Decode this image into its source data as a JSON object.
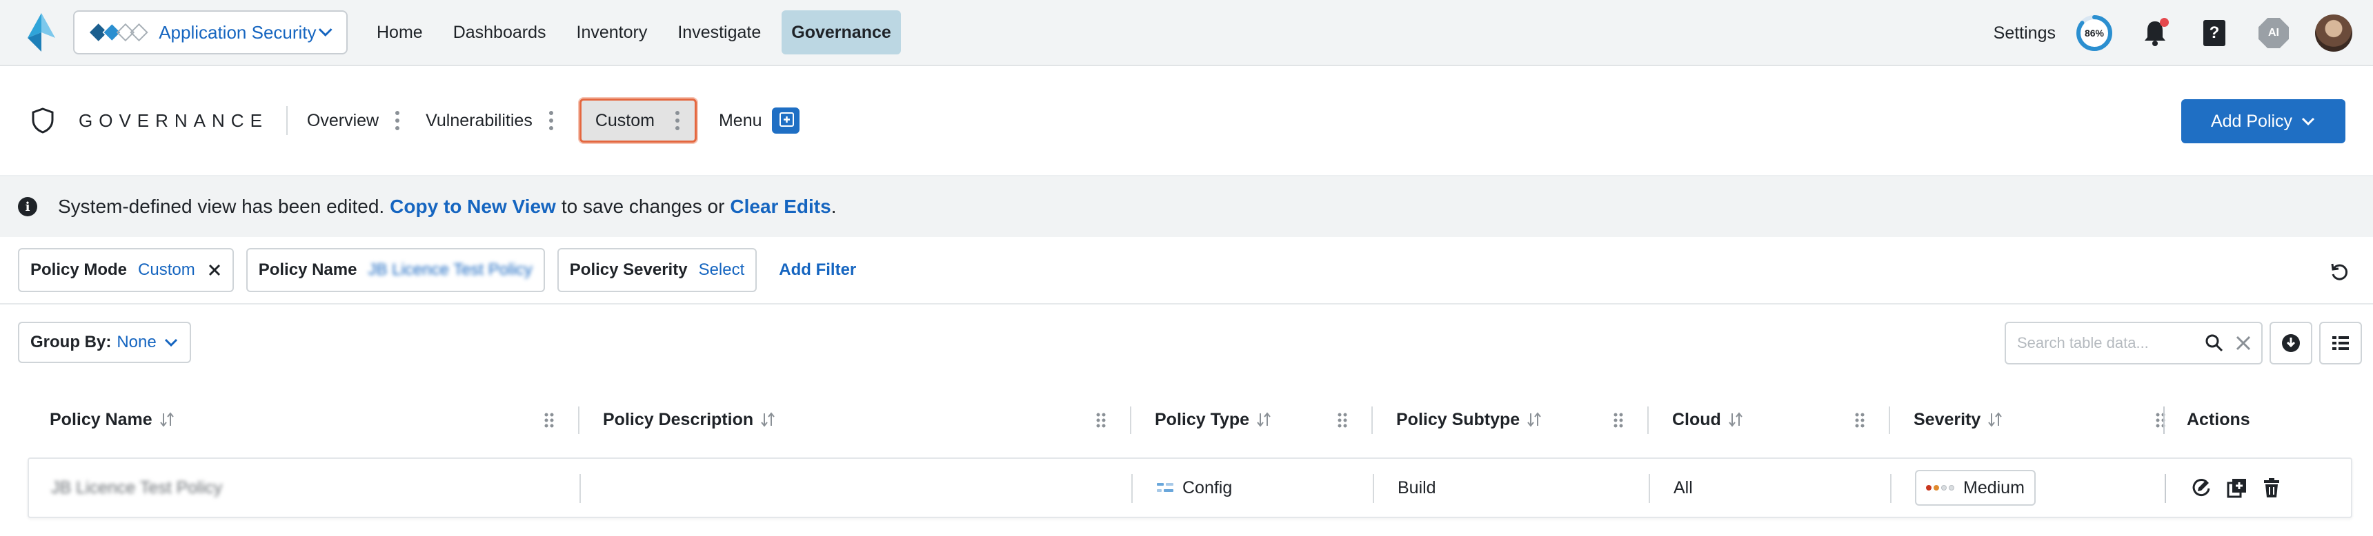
{
  "topbar": {
    "app_name": "Application Security",
    "nav": [
      "Home",
      "Dashboards",
      "Inventory",
      "Investigate",
      "Governance"
    ],
    "active_nav": "Governance",
    "settings_label": "Settings",
    "progress_percent": 86,
    "progress_label": "86%",
    "help_glyph": "?",
    "ai_label": "AI",
    "icons": [
      "app-logo-icon",
      "bell-icon",
      "help-book-icon",
      "ai-chip-icon",
      "avatar"
    ]
  },
  "header": {
    "title": "GOVERNANCE",
    "tabs": {
      "overview": "Overview",
      "vulnerabilities": "Vulnerabilities",
      "custom": "Custom"
    },
    "menu_label": "Menu",
    "add_policy_label": "Add Policy"
  },
  "banner": {
    "text_before": "System-defined view has been edited.",
    "copy_link": "Copy to New View",
    "text_middle": "to save changes or",
    "clear_link": "Clear Edits",
    "text_after": "."
  },
  "filters": {
    "policy_mode_label": "Policy Mode",
    "policy_mode_value": "Custom",
    "policy_name_label": "Policy Name",
    "policy_name_value": "JB Licence Test Policy",
    "policy_severity_label": "Policy Severity",
    "policy_severity_value": "Select",
    "add_filter_label": "Add Filter"
  },
  "controls": {
    "group_by_label": "Group By:",
    "group_by_value": "None",
    "search_placeholder": "Search table data..."
  },
  "table": {
    "columns": {
      "name": "Policy Name",
      "description": "Policy Description",
      "type": "Policy Type",
      "subtype": "Policy Subtype",
      "cloud": "Cloud",
      "severity": "Severity",
      "actions": "Actions"
    },
    "rows": [
      {
        "name": "JB Licence Test Policy",
        "description": "",
        "type": "Config",
        "subtype": "Build",
        "cloud": "All",
        "severity": "Medium"
      }
    ]
  },
  "colors": {
    "accent": "#1f6fc4",
    "link": "#1565c0",
    "active_nav_bg": "#bcd7e3",
    "custom_tab_outline": "#e4673f",
    "severity_medium": "#e08a2e"
  }
}
